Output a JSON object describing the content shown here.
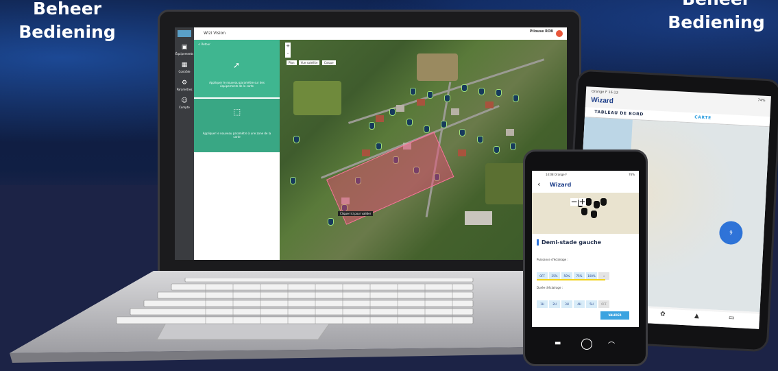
{
  "headings": {
    "left_line1": "Beheer",
    "left_line2": "Bediening",
    "right_line1": "Beheer",
    "right_line2": "Bediening"
  },
  "laptop_app": {
    "title": "Wizi Vision",
    "user_name": "Pilouse ROB",
    "sidebar": [
      {
        "label": "Équipements",
        "icon": "building-icon"
      },
      {
        "label": "Contrôle",
        "icon": "grid-icon"
      },
      {
        "label": "Paramètres",
        "icon": "gear-icon"
      },
      {
        "label": "Compte",
        "icon": "user-icon"
      }
    ],
    "panel_back": "< Retour",
    "panel_option1": "Appliquer le nouveau paramètre sur des équipements de la carte",
    "panel_option2": "Appliquer le nouveau paramètre à une zone de la carte",
    "map_buttons": [
      "Plan",
      "Vue satellite",
      "Calque"
    ],
    "map_zoom": [
      "+",
      "-"
    ],
    "map_tooltip": "Cliquer ici pour valider"
  },
  "tablet": {
    "status_left": "Orange F 16:13",
    "status_right": "74%",
    "title": "Wizard",
    "tab_dashboard": "TABLEAU DE BORD",
    "tab_map": "CARTE",
    "cluster_count": "9",
    "zoom_minus": "−",
    "zoom_plus": "+"
  },
  "phone": {
    "status_left": "14:08 Orange F",
    "status_right": "76%",
    "title": "Wizard",
    "zoom_minus": "−",
    "zoom_plus": "+",
    "section_title": "Demi-stade gauche",
    "power_label": "Puissance d'éclairage :",
    "power_options": [
      "OFF",
      "25%",
      "50%",
      "75%",
      "100%",
      "↓"
    ],
    "duration_label": "Durée d'éclairage :",
    "duration_options": [
      "1H",
      "2H",
      "3H",
      "4H",
      "5H",
      "OFF"
    ],
    "validate_button": "VALIDER"
  },
  "colors": {
    "background": "#0d1a3c",
    "panel_green": "#3fb690",
    "accent_blue": "#2f73d8",
    "selection_pink": "#f04678",
    "app_title_blue": "#1e3f8a"
  }
}
